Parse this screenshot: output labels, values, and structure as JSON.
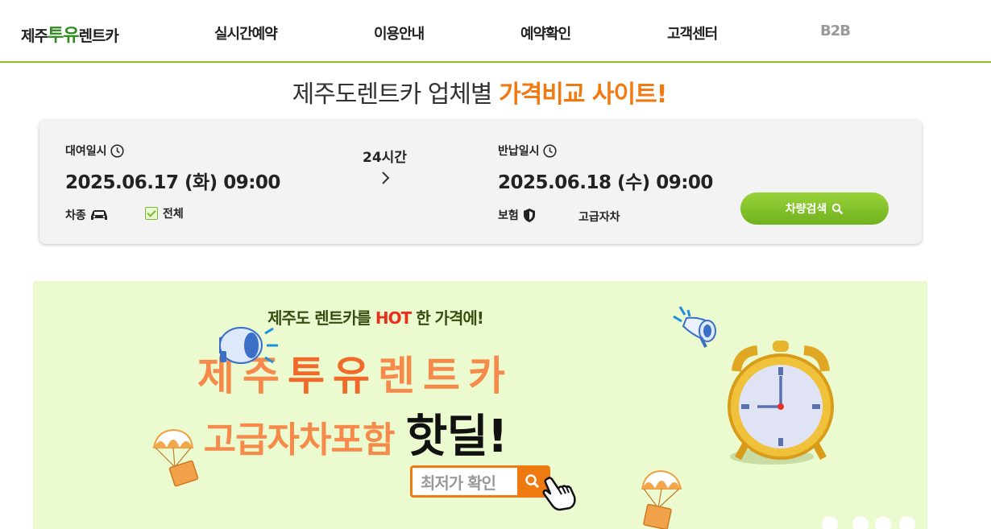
{
  "nav": {
    "logo_prefix": "제주",
    "logo_highlight": "투유",
    "logo_suffix": "렌트카",
    "items": [
      "실시간예약",
      "이용안내",
      "예약확인",
      "고객센터",
      "B2B"
    ]
  },
  "headline": {
    "text": "제주도렌트카 업체별 ",
    "highlight": "가격비교 사이트!"
  },
  "search": {
    "pickup_label": "대여일시",
    "pickup_date": "2025.06.17 (화) 09:00",
    "duration": "24시간",
    "return_label": "반납일시",
    "return_date": "2025.06.18 (수) 09:00",
    "car_type_label": "차종",
    "car_type_all": "전체",
    "insurance_label": "보험",
    "insurance_value": "고급자차",
    "search_button": "차량검색"
  },
  "banner": {
    "top_line_prefix": "제주도 렌트카를 ",
    "top_line_hot": "HOT",
    "top_line_suffix": " 한 가격에!",
    "title_line1_a": "제주",
    "title_line1_b": "투유",
    "title_line1_c": "렌트카",
    "title_line2_a": "고급자차포함 ",
    "title_line2_b": "핫딜!",
    "cta_label": "최저가 확인"
  },
  "colors": {
    "accent_green": "#8dbb2a",
    "accent_orange": "#f07a12",
    "banner_bg": "#ebfbcf"
  }
}
